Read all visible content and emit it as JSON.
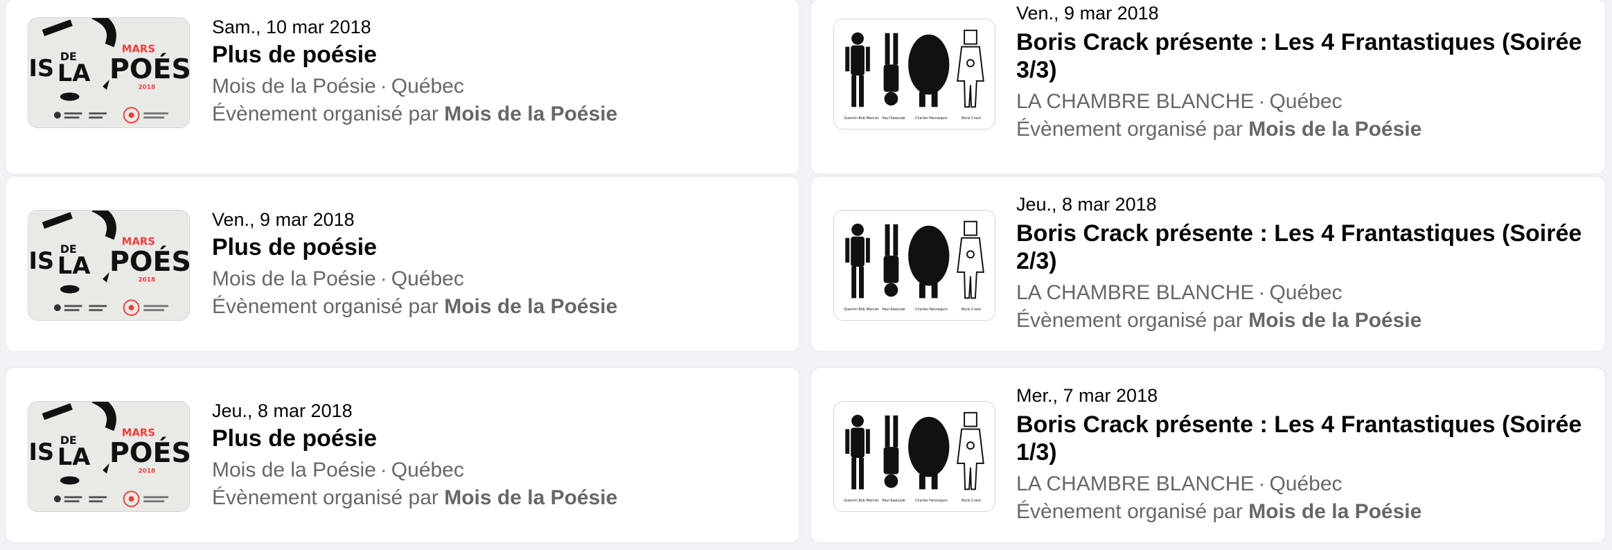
{
  "events": {
    "left": [
      {
        "date": "Sam., 10 mar 2018",
        "title": "Plus de poésie",
        "venue": "Mois de la Poésie",
        "city": "Québec",
        "organizer_prefix": "Évènement organisé par",
        "organizer": "Mois de la Poésie"
      },
      {
        "date": "Ven., 9 mar 2018",
        "title": "Plus de poésie",
        "venue": "Mois de la Poésie",
        "city": "Québec",
        "organizer_prefix": "Évènement organisé par",
        "organizer": "Mois de la Poésie"
      },
      {
        "date": "Jeu., 8 mar 2018",
        "title": "Plus de poésie",
        "venue": "Mois de la Poésie",
        "city": "Québec",
        "organizer_prefix": "Évènement organisé par",
        "organizer": "Mois de la Poésie"
      }
    ],
    "right": [
      {
        "date": "Ven., 9 mar 2018",
        "title": "Boris Crack présente : Les 4 Frantastiques (Soirée 3/3)",
        "venue": "LA CHAMBRE BLANCHE",
        "city": "Québec",
        "organizer_prefix": "Évènement organisé par",
        "organizer": "Mois de la Poésie"
      },
      {
        "date": "Jeu., 8 mar 2018",
        "title": "Boris Crack présente : Les 4 Frantastiques (Soirée 2/3)",
        "venue": "LA CHAMBRE BLANCHE",
        "city": "Québec",
        "organizer_prefix": "Évènement organisé par",
        "organizer": "Mois de la Poésie"
      },
      {
        "date": "Mer., 7 mar 2018",
        "title": "Boris Crack présente : Les 4 Frantastiques (Soirée 1/3)",
        "venue": "LA CHAMBRE BLANCHE",
        "city": "Québec",
        "organizer_prefix": "Évènement organisé par",
        "organizer": "Mois de la Poésie"
      }
    ]
  },
  "separator": "·",
  "poster_poesie": {
    "words": [
      "IS",
      "DE",
      "LA",
      "MARS",
      "POÉS",
      "2018"
    ],
    "icon": "poetry-poster-image"
  },
  "poster_frantastiques": {
    "names": [
      "Quentin Bob Mercier",
      "Paul Kawczak",
      "Charles Hennequin",
      "Boris Crack"
    ],
    "icon": "four-figures-poster-image"
  },
  "colors": {
    "accent_red": "#e8413c",
    "text_primary": "#050505",
    "text_secondary": "#65676b"
  }
}
